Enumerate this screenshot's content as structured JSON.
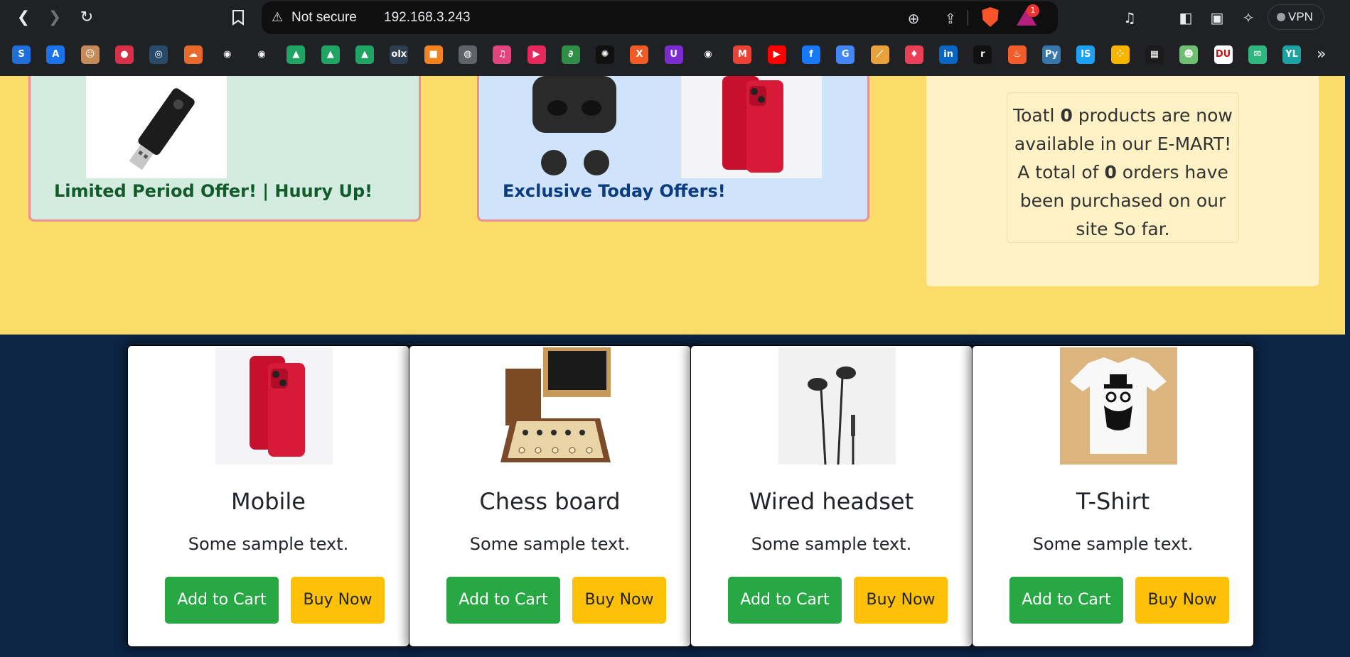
{
  "browser": {
    "security_label": "Not secure",
    "url": "192.168.3.243",
    "vpn_label": "VPN",
    "rewards_count": "1",
    "nav_glyphs": {
      "back": "❮",
      "forward": "❯",
      "reload": "↻",
      "bookmark": "⌑"
    },
    "bookmarks": [
      {
        "name": "bookmark-s",
        "glyph": "S",
        "color": "#1e6fd9"
      },
      {
        "name": "bookmark-azure",
        "glyph": "A",
        "color": "#1a73e8"
      },
      {
        "name": "bookmark-avatar",
        "glyph": "☺",
        "color": "#c58c5a"
      },
      {
        "name": "bookmark-red-circle",
        "glyph": "●",
        "color": "#d9304a"
      },
      {
        "name": "bookmark-dark-circle",
        "glyph": "◎",
        "color": "#2a4a6a"
      },
      {
        "name": "bookmark-cloud",
        "glyph": "☁",
        "color": "#e8692c"
      },
      {
        "name": "bookmark-github-1",
        "glyph": "◉",
        "color": "#202124"
      },
      {
        "name": "bookmark-github-2",
        "glyph": "◉",
        "color": "#202124"
      },
      {
        "name": "bookmark-drive-1",
        "glyph": "▲",
        "color": "#1fa463"
      },
      {
        "name": "bookmark-drive-2",
        "glyph": "▲",
        "color": "#1fa463"
      },
      {
        "name": "bookmark-drive-3",
        "glyph": "▲",
        "color": "#1fa463"
      },
      {
        "name": "bookmark-olx",
        "glyph": "olx",
        "color": "#2c3e50"
      },
      {
        "name": "bookmark-box",
        "glyph": "■",
        "color": "#f58220"
      },
      {
        "name": "bookmark-globe",
        "glyph": "◍",
        "color": "#5f6368"
      },
      {
        "name": "bookmark-music",
        "glyph": "♫",
        "color": "#e0457b"
      },
      {
        "name": "bookmark-play",
        "glyph": "▶",
        "color": "#e8275c"
      },
      {
        "name": "bookmark-gfg",
        "glyph": "∂",
        "color": "#2f8d46"
      },
      {
        "name": "bookmark-openai",
        "glyph": "✺",
        "color": "#101010"
      },
      {
        "name": "bookmark-x",
        "glyph": "X",
        "color": "#f15a24"
      },
      {
        "name": "bookmark-udemy",
        "glyph": "U",
        "color": "#7b2cd1"
      },
      {
        "name": "bookmark-github-3",
        "glyph": "◉",
        "color": "#202124"
      },
      {
        "name": "bookmark-gmail",
        "glyph": "M",
        "color": "#ea4335"
      },
      {
        "name": "bookmark-youtube",
        "glyph": "▶",
        "color": "#ff0000"
      },
      {
        "name": "bookmark-facebook",
        "glyph": "f",
        "color": "#1877f2"
      },
      {
        "name": "bookmark-translate",
        "glyph": "G",
        "color": "#4285f4"
      },
      {
        "name": "bookmark-slash",
        "glyph": "⟋",
        "color": "#e9a13b"
      },
      {
        "name": "bookmark-rocket",
        "glyph": "♦",
        "color": "#e94057"
      },
      {
        "name": "bookmark-linkedin",
        "glyph": "in",
        "color": "#0a66c2"
      },
      {
        "name": "bookmark-r",
        "glyph": "r",
        "color": "#111111"
      },
      {
        "name": "bookmark-fire",
        "glyph": "♨",
        "color": "#f25c2a"
      },
      {
        "name": "bookmark-python",
        "glyph": "Py",
        "color": "#3776ab"
      },
      {
        "name": "bookmark-is",
        "glyph": "IS",
        "color": "#1da1f2"
      },
      {
        "name": "bookmark-dots",
        "glyph": "⁘",
        "color": "#f7b500"
      },
      {
        "name": "bookmark-grid",
        "glyph": "▦",
        "color": "#1b1b1b"
      },
      {
        "name": "bookmark-people",
        "glyph": "☻",
        "color": "#6fbf73"
      },
      {
        "name": "bookmark-du",
        "glyph": "DU",
        "color": "#ffffff"
      },
      {
        "name": "bookmark-chat",
        "glyph": "✉",
        "color": "#2fb77f"
      },
      {
        "name": "bookmark-yl",
        "glyph": "YL",
        "color": "#1da1a1"
      }
    ]
  },
  "offers": {
    "green_title": "Limited Period Offer! | Huury Up!",
    "blue_title": "Exclusive Today Offers!"
  },
  "stats": {
    "line1_pre": "Toatl ",
    "product_count": "0",
    "line1_post": " products are now available in our E-MART!",
    "line2_pre": "A total of ",
    "order_count": "0",
    "line2_post": " orders have been purchased on our site So far."
  },
  "products": [
    {
      "title": "Mobile",
      "desc": "Some sample text.",
      "cart": "Add to Cart",
      "buy": "Buy Now",
      "image": "phone"
    },
    {
      "title": "Chess board",
      "desc": "Some sample text.",
      "cart": "Add to Cart",
      "buy": "Buy Now",
      "image": "chess"
    },
    {
      "title": "Wired headset",
      "desc": "Some sample text.",
      "cart": "Add to Cart",
      "buy": "Buy Now",
      "image": "earphones"
    },
    {
      "title": "T-Shirt",
      "desc": "Some sample text.",
      "cart": "Add to Cart",
      "buy": "Buy Now",
      "image": "tshirt"
    }
  ],
  "colors": {
    "offer_green_bg": "#d4ebdf",
    "offer_blue_bg": "#cfe3fb",
    "banner_bg": "#fcdc68",
    "page_bg": "#0d2444",
    "cart_button": "#28a745",
    "buy_button": "#ffc107"
  }
}
